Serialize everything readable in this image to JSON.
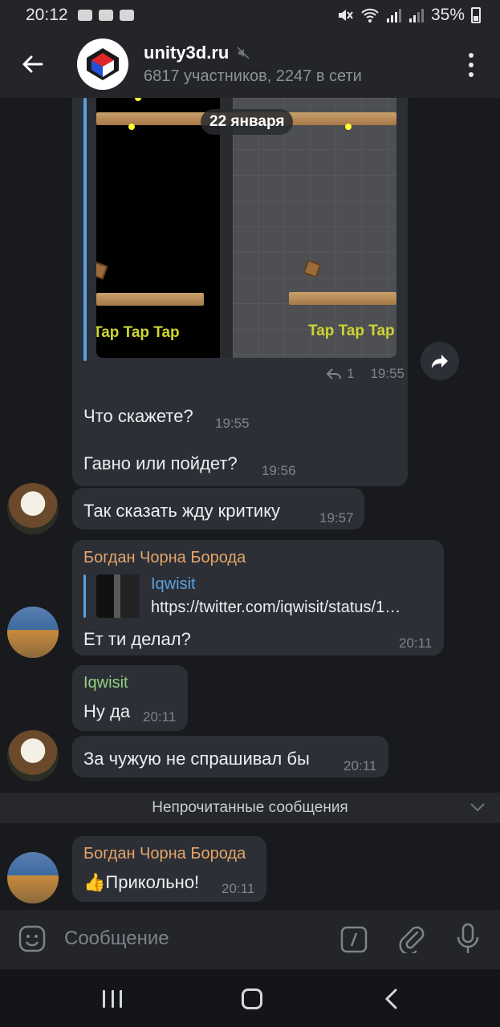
{
  "status_bar": {
    "time": "20:12",
    "battery": "35%"
  },
  "header": {
    "title": "unity3d.ru",
    "subtitle": "6817 участников, 2247 в сети"
  },
  "date_pill": "22 января",
  "media_message": {
    "game_text_left": "Tap Tap Tap",
    "game_text_right": "Tap Tap Tap",
    "reply_count": "1",
    "time": "19:55"
  },
  "messages": [
    {
      "text": "Что скажете?",
      "time": "19:55"
    },
    {
      "text": "Гавно или пойдет?",
      "time": "19:56"
    },
    {
      "text": "Так сказать жду критику",
      "time": "19:57"
    }
  ],
  "reply_message": {
    "sender": "Богдан Чорна Борода",
    "quote_title": "Iqwisit",
    "quote_text": "https://twitter.com/iqwisit/status/1…",
    "text": "Ет ти делал?",
    "time": "20:11"
  },
  "own_reply": {
    "sender": "Iqwisit",
    "text": "Ну да",
    "time": "20:11"
  },
  "eagle_message": {
    "text": "За чужую не спрашивал бы",
    "time": "20:11"
  },
  "unread_label": "Непрочитанные сообщения",
  "last_message": {
    "sender": "Богдан Чорна Борода",
    "emoji": "👍",
    "text": "Прикольно!",
    "time": "20:11"
  },
  "composer": {
    "placeholder": "Сообщение"
  },
  "colors": {
    "accent": "#5aa0e0",
    "sender_orange": "#e7a56a",
    "sender_green": "#8fd080"
  }
}
